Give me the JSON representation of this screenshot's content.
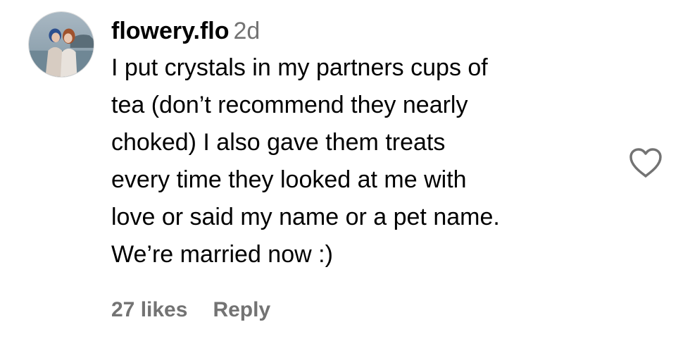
{
  "comment": {
    "username": "flowery.flo",
    "timestamp": "2d",
    "text_lines": [
      "I put crystals in my partners cups of",
      "tea (don’t recommend they nearly",
      "choked) I also gave them treats",
      "every time they looked at me with",
      "love or said my name or a pet name.",
      "We’re married now :)"
    ],
    "likes": "27 likes",
    "reply_label": "Reply",
    "like_icon": "heart-outline-icon"
  },
  "colors": {
    "text": "#000000",
    "secondary": "#737373",
    "background": "#ffffff"
  }
}
